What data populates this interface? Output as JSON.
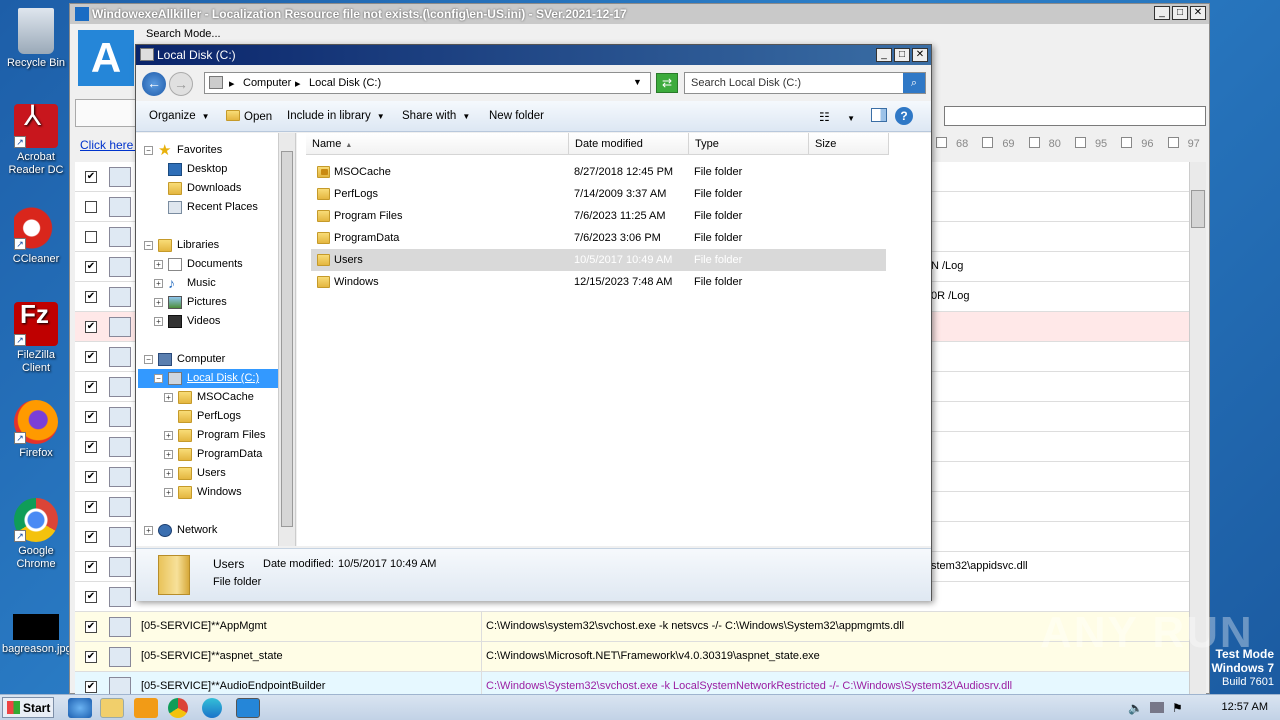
{
  "desktop": {
    "icons": [
      {
        "label": "Recycle Bin",
        "icon": "recycle-bin-icon"
      },
      {
        "label": "Acrobat Reader DC",
        "icon": "acrobat-icon"
      },
      {
        "label": "CCleaner",
        "icon": "ccleaner-icon"
      },
      {
        "label": "FileZilla Client",
        "icon": "filezilla-icon"
      },
      {
        "label": "Firefox",
        "icon": "firefox-icon"
      },
      {
        "label": "Google Chrome",
        "icon": "chrome-icon"
      },
      {
        "label": "bagreason.jpg",
        "icon": "image-file-icon"
      }
    ],
    "watermark": "ANY RUN",
    "test_mode": {
      "line1": "Test Mode",
      "line2": "Windows 7",
      "line3": "Build 7601"
    }
  },
  "taskbar": {
    "start_label": "Start",
    "clock": "12:57 AM",
    "pinned": [
      "internet-explorer-icon",
      "explorer-icon",
      "media-player-icon",
      "chrome-icon",
      "edge-icon",
      "app-icon"
    ]
  },
  "app": {
    "title": "WindowexeAllkiller - Localization Resource file not exists.(\\config\\en-US.ini) - SVer.2021-12-17",
    "search_mode": "Search Mode...",
    "click_here": "Click here t",
    "numbers": [
      "68",
      "69",
      "80",
      "95",
      "96",
      "97"
    ],
    "rows": [
      {
        "checked": true,
        "c1": "",
        "c2": "",
        "c2r": ""
      },
      {
        "checked": false,
        "c1": "",
        "c2": "",
        "c2r": ""
      },
      {
        "checked": false,
        "c1": "",
        "c2": "",
        "c2r": ""
      },
      {
        "checked": true,
        "c1": "",
        "c2": "",
        "c2r": "N /Log"
      },
      {
        "checked": true,
        "c1": "",
        "c2": "",
        "c2r": "0R /Log"
      },
      {
        "checked": true,
        "c1": "",
        "c2": "",
        "c2r": ""
      },
      {
        "checked": true,
        "c1": "",
        "c2": "",
        "c2r": ""
      },
      {
        "checked": true,
        "c1": "",
        "c2": "",
        "c2r": ""
      },
      {
        "checked": true,
        "c1": "",
        "c2": "",
        "c2r": ""
      },
      {
        "checked": true,
        "c1": "",
        "c2": "",
        "c2r": ""
      },
      {
        "checked": true,
        "c1": "",
        "c2": "",
        "c2r": ""
      },
      {
        "checked": true,
        "c1": "",
        "c2": "",
        "c2r": ""
      },
      {
        "checked": true,
        "c1": "",
        "c2": "",
        "c2r": ""
      },
      {
        "checked": true,
        "c1": "",
        "c2": "",
        "c2r": "stem32\\appidsvc.dll"
      },
      {
        "checked": true,
        "c1": "",
        "c2": "",
        "c2r": ""
      },
      {
        "checked": true,
        "c1": "[05-SERVICE]**AppMgmt",
        "c2": "C:\\Windows\\system32\\svchost.exe -k netsvcs -/- C:\\Windows\\System32\\appmgmts.dll",
        "c2r": ""
      },
      {
        "checked": true,
        "c1": "[05-SERVICE]**aspnet_state",
        "c2": "C:\\Windows\\Microsoft.NET\\Framework\\v4.0.30319\\aspnet_state.exe",
        "c2r": ""
      },
      {
        "checked": true,
        "c1": "[05-SERVICE]**AudioEndpointBuilder",
        "c2": "C:\\Windows\\System32\\svchost.exe -k LocalSystemNetworkRestricted -/- C:\\Windows\\System32\\Audiosrv.dll",
        "c2r": ""
      }
    ]
  },
  "explorer": {
    "title": "Local Disk (C:)",
    "breadcrumb": [
      "Computer",
      "Local Disk (C:)"
    ],
    "search_placeholder": "Search Local Disk (C:)",
    "toolbar": {
      "organize": "Organize",
      "open": "Open",
      "include": "Include in library",
      "share": "Share with",
      "new_folder": "New folder"
    },
    "nav": {
      "favorites": "Favorites",
      "desktop": "Desktop",
      "downloads": "Downloads",
      "recent": "Recent Places",
      "libraries": "Libraries",
      "documents": "Documents",
      "music": "Music",
      "pictures": "Pictures",
      "videos": "Videos",
      "computer": "Computer",
      "local_disk": "Local Disk (C:)",
      "msocache": "MSOCache",
      "perflogs": "PerfLogs",
      "program_files": "Program Files",
      "programdata": "ProgramData",
      "users": "Users",
      "windows": "Windows",
      "network": "Network"
    },
    "columns": {
      "name": "Name",
      "date": "Date modified",
      "type": "Type",
      "size": "Size"
    },
    "files": [
      {
        "name": "MSOCache",
        "date": "8/27/2018 12:45 PM",
        "type": "File folder"
      },
      {
        "name": "PerfLogs",
        "date": "7/14/2009 3:37 AM",
        "type": "File folder"
      },
      {
        "name": "Program Files",
        "date": "7/6/2023 11:25 AM",
        "type": "File folder"
      },
      {
        "name": "ProgramData",
        "date": "7/6/2023 3:06 PM",
        "type": "File folder"
      },
      {
        "name": "Users",
        "date": "10/5/2017 10:49 AM",
        "type": "File folder"
      },
      {
        "name": "Windows",
        "date": "12/15/2023 7:48 AM",
        "type": "File folder"
      }
    ],
    "details": {
      "name": "Users",
      "date_label": "Date modified:",
      "date": "10/5/2017 10:49 AM",
      "type": "File folder"
    }
  }
}
